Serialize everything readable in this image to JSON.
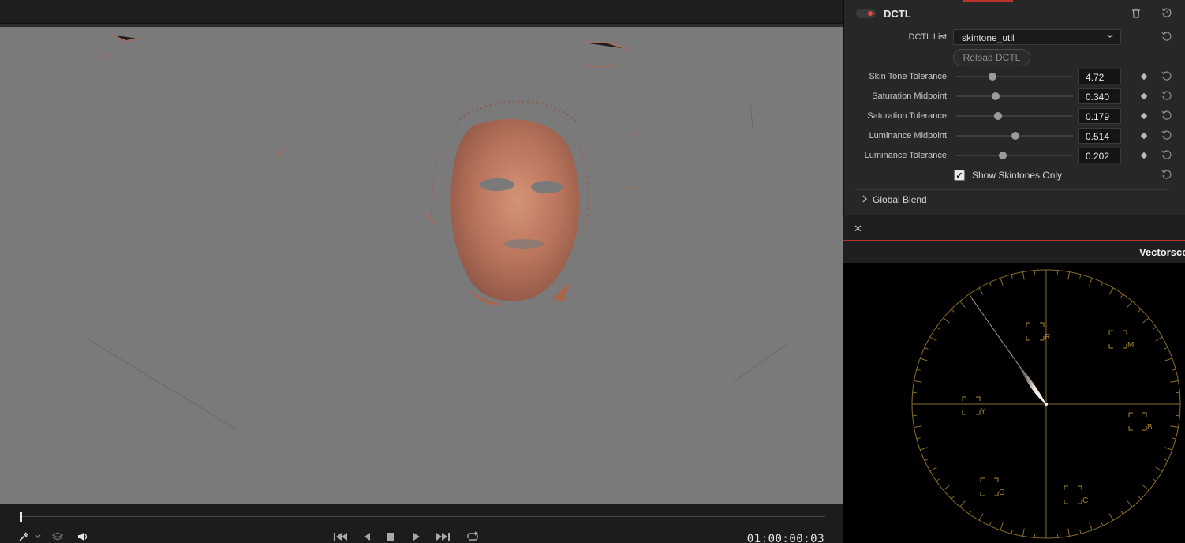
{
  "viewer": {
    "timecode": "01:00:00:03"
  },
  "transport": {
    "icons": [
      "eyedropper-icon",
      "chevron-down-icon",
      "layers-icon",
      "speaker-icon",
      "skip-back-icon",
      "step-back-icon",
      "stop-icon",
      "play-icon",
      "skip-forward-icon",
      "loop-icon"
    ],
    "playhead_fraction": 0.0
  },
  "dctl": {
    "title": "DCTL",
    "enabled": true,
    "list_label": "DCTL List",
    "list_value": "skintone_util",
    "reload_label": "Reload DCTL",
    "params": [
      {
        "label": "Skin Tone Tolerance",
        "value": "4.72",
        "fraction": 0.31
      },
      {
        "label": "Saturation Midpoint",
        "value": "0.340",
        "fraction": 0.34
      },
      {
        "label": "Saturation Tolerance",
        "value": "0.179",
        "fraction": 0.36
      },
      {
        "label": "Luminance Midpoint",
        "value": "0.514",
        "fraction": 0.51
      },
      {
        "label": "Luminance Tolerance",
        "value": "0.202",
        "fraction": 0.4
      }
    ],
    "show_skintones_label": "Show Skintones Only",
    "show_skintones_checked": true,
    "global_blend_label": "Global Blend"
  },
  "scope": {
    "title": "Vectorscope",
    "targets": [
      "R",
      "M",
      "Y",
      "B",
      "G",
      "C"
    ],
    "accent_color": "#a8862e"
  },
  "colors": {
    "accent_red": "#c0332e",
    "viewer_gray": "#7a7a7b",
    "panel_bg": "#27272a"
  }
}
